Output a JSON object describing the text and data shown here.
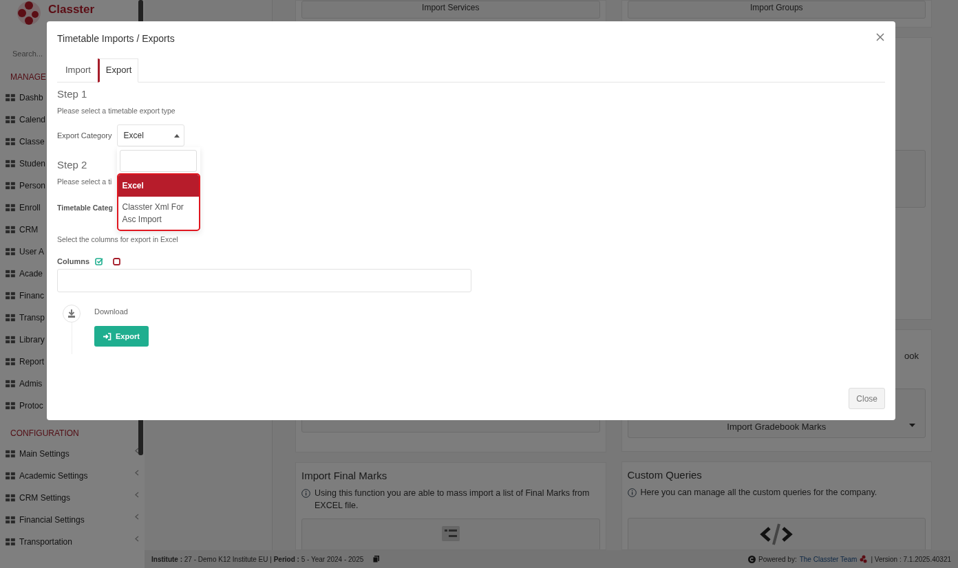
{
  "sidebar": {
    "logo_text": "Classter",
    "search": {
      "placeholder": "Search..."
    },
    "sections": [
      {
        "heading": "MANAGE",
        "items": [
          {
            "label": "Dashb"
          },
          {
            "label": "Calend"
          },
          {
            "label": "Classe"
          },
          {
            "label": "Studen"
          },
          {
            "label": "Person"
          },
          {
            "label": "Enroll"
          },
          {
            "label": "CRM"
          },
          {
            "label": "User A"
          },
          {
            "label": "Acade"
          },
          {
            "label": "Financ"
          },
          {
            "label": "Transp"
          },
          {
            "label": "Library"
          },
          {
            "label": "Report"
          },
          {
            "label": "Admis"
          },
          {
            "label": "Protoc"
          }
        ]
      },
      {
        "heading": "CONFIGURATION",
        "items": [
          {
            "label": "Main Settings",
            "expandable": true
          },
          {
            "label": "Academic Settings",
            "expandable": true
          },
          {
            "label": "CRM Settings",
            "expandable": true
          },
          {
            "label": "Financial Settings",
            "expandable": true
          },
          {
            "label": "Transportation",
            "expandable": true
          }
        ]
      }
    ]
  },
  "background": {
    "top_buttons": [
      "Import Services",
      "Import Groups"
    ],
    "partial_text": "ook",
    "gradebook_button": "Import Gradebook Marks",
    "cards": [
      {
        "title": "Import Final Marks",
        "info": "Using this function you are able to mass import a list of Final Marks from EXCEL file."
      },
      {
        "title": "Custom Queries",
        "info": "Here you can manage all the custom queries for the company."
      }
    ]
  },
  "modal": {
    "title": "Timetable Imports / Exports",
    "tabs": [
      {
        "label": "Import",
        "selected": false
      },
      {
        "label": "Export",
        "selected": true
      }
    ],
    "step1": {
      "heading": "Step 1",
      "hint": "Please select a timetable export type",
      "label": "Export Category",
      "value": "Excel",
      "dropdown": {
        "options": [
          {
            "label": "Excel",
            "selected": true
          },
          {
            "label": "Classter Xml For Asc Import",
            "selected": false
          }
        ]
      }
    },
    "step2": {
      "heading": "Step 2",
      "hint": "Please select a ti",
      "label": "Timetable Categ"
    },
    "columns_hint": "Select the columns for export in Excel",
    "columns_label": "Columns",
    "download_label": "Download",
    "export_button": "Export",
    "close_button": "Close"
  },
  "footer": {
    "left": "**Institute :** 27 - Demo K12 Institute EU | **Period :** 5 - Year 2024 - 2025",
    "powered": "Powered by:",
    "link": "The Classter Team",
    "version": "| Version : 7.1.2025.40321"
  }
}
